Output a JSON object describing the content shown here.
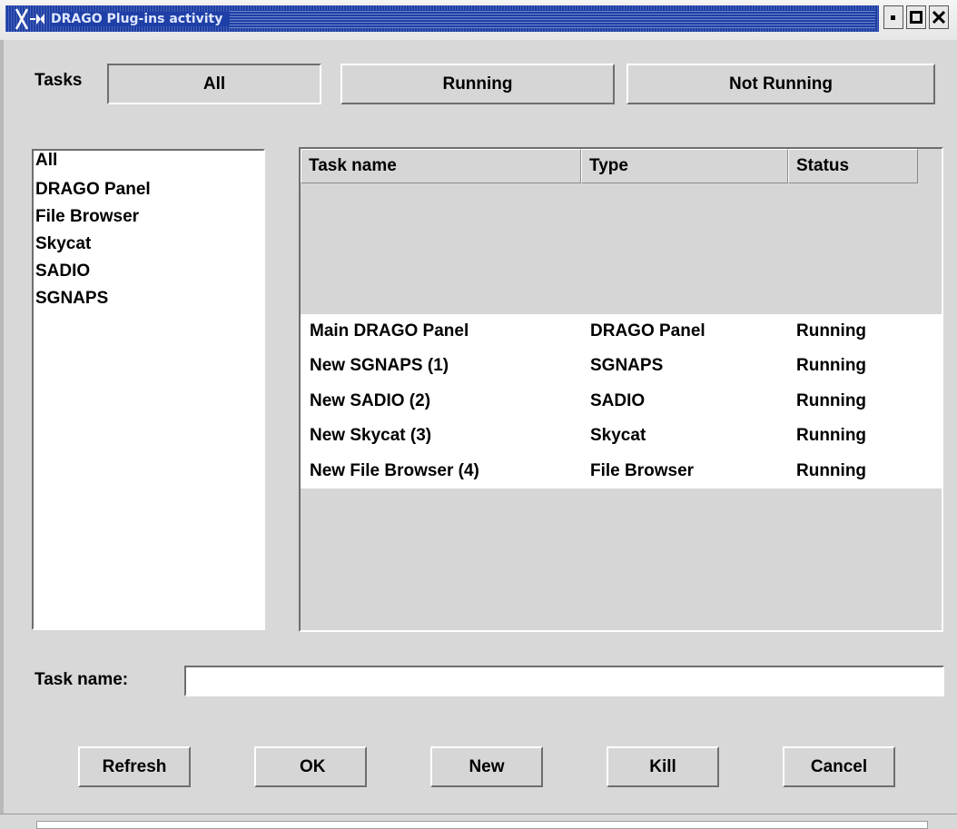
{
  "window": {
    "title": "DRAGO Plug-ins activity"
  },
  "filter": {
    "label": "Tasks",
    "buttons": [
      "All",
      "Running",
      "Not Running"
    ]
  },
  "plugin_list": [
    "All",
    "DRAGO Panel",
    "File Browser",
    "Skycat",
    "SADIO",
    "SGNAPS"
  ],
  "table": {
    "columns": [
      "Task name",
      "Type",
      "Status"
    ],
    "rows": [
      [
        "Main DRAGO Panel",
        "DRAGO Panel",
        "Running"
      ],
      [
        "New SGNAPS (1)",
        "SGNAPS",
        "Running"
      ],
      [
        "New SADIO (2)",
        "SADIO",
        "Running"
      ],
      [
        "New Skycat (3)",
        "Skycat",
        "Running"
      ],
      [
        "New File Browser (4)",
        "File Browser",
        "Running"
      ]
    ]
  },
  "task_name": {
    "label": "Task name:",
    "value": ""
  },
  "actions": [
    "Refresh",
    "OK",
    "New",
    "Kill",
    "Cancel"
  ],
  "colors": {
    "titlebar": "#1e3fa6",
    "background": "#d8d8d8",
    "list_bg": "#ffffff"
  }
}
